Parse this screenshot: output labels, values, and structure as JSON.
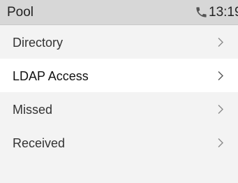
{
  "status_bar": {
    "title": "Pool",
    "time": "13:19",
    "call_icon": "phone-handset-icon"
  },
  "menu": {
    "selected_index": 1,
    "items": [
      {
        "label": "Directory",
        "icon": "chevron-right-icon"
      },
      {
        "label": "LDAP Access",
        "icon": "chevron-right-icon"
      },
      {
        "label": "Missed",
        "icon": "chevron-right-icon"
      },
      {
        "label": "Received",
        "icon": "chevron-right-icon"
      }
    ]
  },
  "colors": {
    "status_bar_bg": "#d7d7d7",
    "list_bg": "#f3f3f3",
    "selected_bg": "#ffffff",
    "phone_icon": "#555555"
  }
}
